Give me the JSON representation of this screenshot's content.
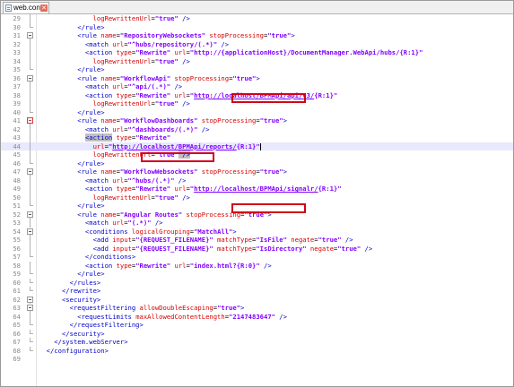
{
  "tab": {
    "label": "web.config",
    "close": "✕"
  },
  "colors": {
    "tag": "#0000c8",
    "attr": "#d50000",
    "value": "#8000ff",
    "highlight": "#e8e8ff",
    "box": "#d0021b"
  },
  "lines": [
    {
      "n": "29",
      "s": [
        {
          "c": "p",
          "t": "              "
        },
        {
          "c": "a",
          "t": "logRewrittenUrl"
        },
        {
          "c": "p",
          "t": "="
        },
        {
          "c": "v",
          "t": "\"true\""
        },
        {
          "c": "t",
          "t": " />"
        }
      ]
    },
    {
      "n": "30",
      "s": [
        {
          "c": "t",
          "t": "          </rule>"
        }
      ]
    },
    {
      "n": "31",
      "s": [
        {
          "c": "t",
          "t": "          <rule "
        },
        {
          "c": "a",
          "t": "name"
        },
        {
          "c": "p",
          "t": "="
        },
        {
          "c": "v",
          "t": "\"RepositoryWebsockets\""
        },
        {
          "c": "a",
          "t": " stopProcessing"
        },
        {
          "c": "p",
          "t": "="
        },
        {
          "c": "v",
          "t": "\"true\""
        },
        {
          "c": "t",
          "t": ">"
        }
      ]
    },
    {
      "n": "32",
      "s": [
        {
          "c": "t",
          "t": "            <match "
        },
        {
          "c": "a",
          "t": "url"
        },
        {
          "c": "p",
          "t": "="
        },
        {
          "c": "v",
          "t": "\"^hubs/repository/(.*)\""
        },
        {
          "c": "t",
          "t": " />"
        }
      ]
    },
    {
      "n": "33",
      "s": [
        {
          "c": "t",
          "t": "            <action "
        },
        {
          "c": "a",
          "t": "type"
        },
        {
          "c": "p",
          "t": "="
        },
        {
          "c": "v",
          "t": "\"Rewrite\""
        },
        {
          "c": "a",
          "t": " url"
        },
        {
          "c": "p",
          "t": "="
        },
        {
          "c": "v",
          "t": "\"http://{applicationHost}/DocumentManager.WebApi/hubs/{R:1}\""
        }
      ]
    },
    {
      "n": "34",
      "s": [
        {
          "c": "p",
          "t": "              "
        },
        {
          "c": "a",
          "t": "logRewrittenUrl"
        },
        {
          "c": "p",
          "t": "="
        },
        {
          "c": "v",
          "t": "\"true\""
        },
        {
          "c": "t",
          "t": " />"
        }
      ]
    },
    {
      "n": "35",
      "s": [
        {
          "c": "t",
          "t": "          </rule>"
        }
      ]
    },
    {
      "n": "36",
      "s": [
        {
          "c": "t",
          "t": "          <rule "
        },
        {
          "c": "a",
          "t": "name"
        },
        {
          "c": "p",
          "t": "="
        },
        {
          "c": "v",
          "t": "\"WorkflowApi\""
        },
        {
          "c": "a",
          "t": " stopProcessing"
        },
        {
          "c": "p",
          "t": "="
        },
        {
          "c": "v",
          "t": "\"true\""
        },
        {
          "c": "t",
          "t": ">"
        }
      ]
    },
    {
      "n": "37",
      "s": [
        {
          "c": "t",
          "t": "            <match "
        },
        {
          "c": "a",
          "t": "url"
        },
        {
          "c": "p",
          "t": "="
        },
        {
          "c": "v",
          "t": "\"^api/(.*)\""
        },
        {
          "c": "t",
          "t": " />"
        }
      ]
    },
    {
      "n": "38",
      "s": [
        {
          "c": "t",
          "t": "            <action "
        },
        {
          "c": "a",
          "t": "type"
        },
        {
          "c": "p",
          "t": "="
        },
        {
          "c": "v",
          "t": "\"Rewrite\""
        },
        {
          "c": "a",
          "t": " url"
        },
        {
          "c": "p",
          "t": "="
        },
        {
          "c": "v",
          "t": "\""
        },
        {
          "c": "v u",
          "t": "http://localhost/BPMApi/api/v3/"
        },
        {
          "c": "v",
          "t": "{R:1}\""
        }
      ]
    },
    {
      "n": "39",
      "s": [
        {
          "c": "p",
          "t": "              "
        },
        {
          "c": "a",
          "t": "logRewrittenUrl"
        },
        {
          "c": "p",
          "t": "="
        },
        {
          "c": "v",
          "t": "\"true\""
        },
        {
          "c": "t",
          "t": " />"
        }
      ]
    },
    {
      "n": "40",
      "s": [
        {
          "c": "t",
          "t": "          </rule>"
        }
      ]
    },
    {
      "n": "41",
      "s": [
        {
          "c": "t",
          "t": "          <rule "
        },
        {
          "c": "a",
          "t": "name"
        },
        {
          "c": "p",
          "t": "="
        },
        {
          "c": "v",
          "t": "\"WorkflowDashboards\""
        },
        {
          "c": "a",
          "t": " stopProcessing"
        },
        {
          "c": "p",
          "t": "="
        },
        {
          "c": "v",
          "t": "\"true\""
        },
        {
          "c": "t",
          "t": ">"
        }
      ]
    },
    {
      "n": "42",
      "s": [
        {
          "c": "t",
          "t": "            <match "
        },
        {
          "c": "a",
          "t": "url"
        },
        {
          "c": "p",
          "t": "="
        },
        {
          "c": "v",
          "t": "\"^dashboards/(.*)\""
        },
        {
          "c": "t",
          "t": " />"
        }
      ]
    },
    {
      "n": "43",
      "s": [
        {
          "c": "p",
          "t": "            "
        },
        {
          "c": "t mark",
          "t": "<action"
        },
        {
          "c": "a",
          "t": " type"
        },
        {
          "c": "p",
          "t": "="
        },
        {
          "c": "v",
          "t": "\"Rewrite\""
        }
      ]
    },
    {
      "n": "44",
      "hl": true,
      "s": [
        {
          "c": "p",
          "t": "              "
        },
        {
          "c": "a",
          "t": "url"
        },
        {
          "c": "p",
          "t": "="
        },
        {
          "c": "v",
          "t": "\""
        },
        {
          "c": "v u",
          "t": "http://localhost/BPMApi/reports/"
        },
        {
          "c": "v",
          "t": "{R:1}\""
        }
      ]
    },
    {
      "n": "45",
      "s": [
        {
          "c": "p",
          "t": "              "
        },
        {
          "c": "a",
          "t": "logRewrittenUrl"
        },
        {
          "c": "p",
          "t": "="
        },
        {
          "c": "v",
          "t": "\"true\""
        },
        {
          "c": "t mark",
          "t": " />"
        }
      ]
    },
    {
      "n": "46",
      "s": [
        {
          "c": "t",
          "t": "          </rule>"
        }
      ]
    },
    {
      "n": "47",
      "s": [
        {
          "c": "t",
          "t": "          <rule "
        },
        {
          "c": "a",
          "t": "name"
        },
        {
          "c": "p",
          "t": "="
        },
        {
          "c": "v",
          "t": "\"WorkflowWebsockets\""
        },
        {
          "c": "a",
          "t": " stopProcessing"
        },
        {
          "c": "p",
          "t": "="
        },
        {
          "c": "v",
          "t": "\"true\""
        },
        {
          "c": "t",
          "t": ">"
        }
      ]
    },
    {
      "n": "48",
      "s": [
        {
          "c": "t",
          "t": "            <match "
        },
        {
          "c": "a",
          "t": "url"
        },
        {
          "c": "p",
          "t": "="
        },
        {
          "c": "v",
          "t": "\"^hubs/(.*)\""
        },
        {
          "c": "t",
          "t": " />"
        }
      ]
    },
    {
      "n": "49",
      "s": [
        {
          "c": "t",
          "t": "            <action "
        },
        {
          "c": "a",
          "t": "type"
        },
        {
          "c": "p",
          "t": "="
        },
        {
          "c": "v",
          "t": "\"Rewrite\""
        },
        {
          "c": "a",
          "t": " url"
        },
        {
          "c": "p",
          "t": "="
        },
        {
          "c": "v",
          "t": "\""
        },
        {
          "c": "v u",
          "t": "http://localhost/BPMApi/signalr/"
        },
        {
          "c": "v",
          "t": "{R:1}\""
        }
      ]
    },
    {
      "n": "50",
      "s": [
        {
          "c": "p",
          "t": "              "
        },
        {
          "c": "a",
          "t": "logRewrittenUrl"
        },
        {
          "c": "p",
          "t": "="
        },
        {
          "c": "v",
          "t": "\"true\""
        },
        {
          "c": "t",
          "t": " />"
        }
      ]
    },
    {
      "n": "51",
      "s": [
        {
          "c": "t",
          "t": "          </rule>"
        }
      ]
    },
    {
      "n": "52",
      "s": [
        {
          "c": "t",
          "t": "          <rule "
        },
        {
          "c": "a",
          "t": "name"
        },
        {
          "c": "p",
          "t": "="
        },
        {
          "c": "v",
          "t": "\"Angular Routes\""
        },
        {
          "c": "a",
          "t": " stopProcessing"
        },
        {
          "c": "p",
          "t": "="
        },
        {
          "c": "v",
          "t": "\"true\""
        },
        {
          "c": "t",
          "t": ">"
        }
      ]
    },
    {
      "n": "53",
      "s": [
        {
          "c": "t",
          "t": "            <match "
        },
        {
          "c": "a",
          "t": "url"
        },
        {
          "c": "p",
          "t": "="
        },
        {
          "c": "v",
          "t": "\"(.*)\""
        },
        {
          "c": "t",
          "t": " />"
        }
      ]
    },
    {
      "n": "54",
      "s": [
        {
          "c": "t",
          "t": "            <conditions "
        },
        {
          "c": "a",
          "t": "logicalGrouping"
        },
        {
          "c": "p",
          "t": "="
        },
        {
          "c": "v",
          "t": "\"MatchAll\""
        },
        {
          "c": "t",
          "t": ">"
        }
      ]
    },
    {
      "n": "55",
      "s": [
        {
          "c": "t",
          "t": "              <add "
        },
        {
          "c": "a",
          "t": "input"
        },
        {
          "c": "p",
          "t": "="
        },
        {
          "c": "v",
          "t": "\"{REQUEST_FILENAME}\""
        },
        {
          "c": "a",
          "t": " matchType"
        },
        {
          "c": "p",
          "t": "="
        },
        {
          "c": "v",
          "t": "\"IsFile\""
        },
        {
          "c": "a",
          "t": " negate"
        },
        {
          "c": "p",
          "t": "="
        },
        {
          "c": "v",
          "t": "\"true\""
        },
        {
          "c": "t",
          "t": " />"
        }
      ]
    },
    {
      "n": "56",
      "s": [
        {
          "c": "t",
          "t": "              <add "
        },
        {
          "c": "a",
          "t": "input"
        },
        {
          "c": "p",
          "t": "="
        },
        {
          "c": "v",
          "t": "\"{REQUEST_FILENAME}\""
        },
        {
          "c": "a",
          "t": " matchType"
        },
        {
          "c": "p",
          "t": "="
        },
        {
          "c": "v",
          "t": "\"IsDirectory\""
        },
        {
          "c": "a",
          "t": " negate"
        },
        {
          "c": "p",
          "t": "="
        },
        {
          "c": "v",
          "t": "\"true\""
        },
        {
          "c": "t",
          "t": " />"
        }
      ]
    },
    {
      "n": "57",
      "s": [
        {
          "c": "t",
          "t": "            </conditions>"
        }
      ]
    },
    {
      "n": "58",
      "s": [
        {
          "c": "t",
          "t": "            <action "
        },
        {
          "c": "a",
          "t": "type"
        },
        {
          "c": "p",
          "t": "="
        },
        {
          "c": "v",
          "t": "\"Rewrite\""
        },
        {
          "c": "a",
          "t": " url"
        },
        {
          "c": "p",
          "t": "="
        },
        {
          "c": "v",
          "t": "\"index.html?{R:0}\""
        },
        {
          "c": "t",
          "t": " />"
        }
      ]
    },
    {
      "n": "59",
      "s": [
        {
          "c": "t",
          "t": "          </rule>"
        }
      ]
    },
    {
      "n": "60",
      "s": [
        {
          "c": "t",
          "t": "        </rules>"
        }
      ]
    },
    {
      "n": "61",
      "s": [
        {
          "c": "t",
          "t": "      </rewrite>"
        }
      ]
    },
    {
      "n": "62",
      "s": [
        {
          "c": "t",
          "t": "      <security>"
        }
      ]
    },
    {
      "n": "63",
      "s": [
        {
          "c": "t",
          "t": "        <requestFiltering "
        },
        {
          "c": "a",
          "t": "allowDoubleEscaping"
        },
        {
          "c": "p",
          "t": "="
        },
        {
          "c": "v",
          "t": "\"true\""
        },
        {
          "c": "t",
          "t": ">"
        }
      ]
    },
    {
      "n": "64",
      "s": [
        {
          "c": "t",
          "t": "          <requestLimits "
        },
        {
          "c": "a",
          "t": "maxAllowedContentLength"
        },
        {
          "c": "p",
          "t": "="
        },
        {
          "c": "v",
          "t": "\"2147483647\""
        },
        {
          "c": "t",
          "t": " />"
        }
      ]
    },
    {
      "n": "65",
      "s": [
        {
          "c": "t",
          "t": "        </requestFiltering>"
        }
      ]
    },
    {
      "n": "66",
      "s": [
        {
          "c": "t",
          "t": "      </security>"
        }
      ]
    },
    {
      "n": "67",
      "s": [
        {
          "c": "t",
          "t": "    </system.webServer>"
        }
      ]
    },
    {
      "n": "68",
      "s": [
        {
          "c": "t",
          "t": "  </configuration>"
        }
      ]
    },
    {
      "n": "69",
      "s": []
    }
  ]
}
